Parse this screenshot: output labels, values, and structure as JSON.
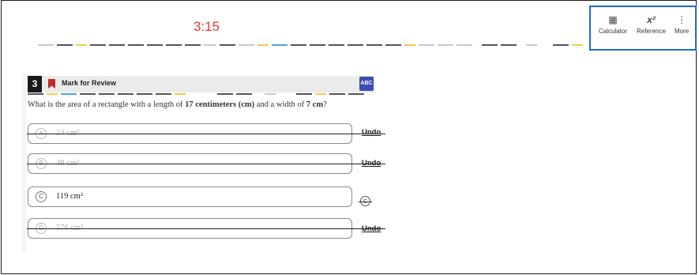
{
  "header": {
    "timer": "3:15",
    "tools": [
      {
        "label": "Calculator",
        "icon": "calculator-icon"
      },
      {
        "label": "Reference",
        "icon": "reference-icon",
        "glyph": "x²"
      },
      {
        "label": "More",
        "icon": "more-vertical-icon"
      }
    ]
  },
  "question": {
    "number": "3",
    "mark_for_review": "Mark for Review",
    "abc_badge": "ABC",
    "prompt_parts": {
      "a": "What is the area of a rectangle with a length of ",
      "b": "17 centimeters (cm)",
      "c": " and a width of ",
      "d": "7 cm",
      "e": "?"
    },
    "options": [
      {
        "letter": "A",
        "value": "24 cm²",
        "eliminated": true,
        "action": "Undo"
      },
      {
        "letter": "B",
        "value": "48 cm²",
        "eliminated": true,
        "action": "Undo"
      },
      {
        "letter": "C",
        "value": "119 cm²",
        "eliminated": false,
        "action": "C"
      },
      {
        "letter": "D",
        "value": "576 cm²",
        "eliminated": true,
        "action": "Undo"
      }
    ]
  },
  "colors": {
    "timer": "#e53935",
    "toolbar_border": "#1e6bd6",
    "bookmark": "#c62828",
    "abc_badge": "#3b4fb3"
  }
}
